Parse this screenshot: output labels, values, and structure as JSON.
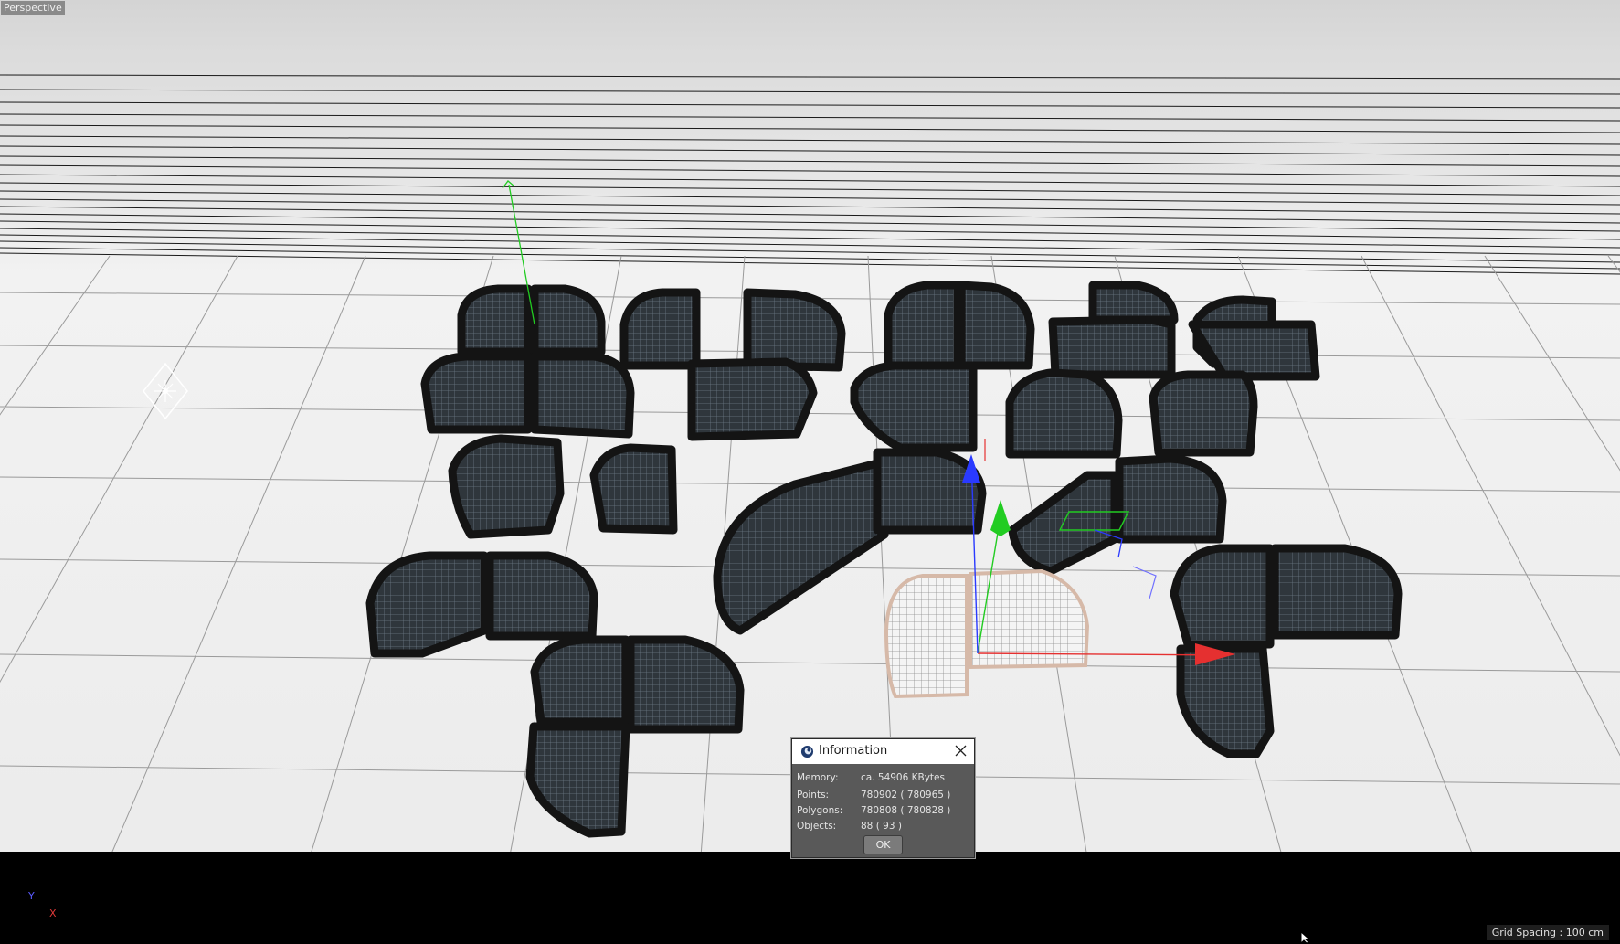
{
  "viewport": {
    "view_name": "Perspective",
    "grid_spacing": "Grid Spacing : 100 cm",
    "axis_indicator": {
      "y_label": "Y",
      "x_label": "X"
    }
  },
  "scene": {
    "object_color": "#1b1b1b",
    "wire_color": "#55606a",
    "selected_color": "#c8c8c8",
    "axis_colors": {
      "x": "#e53030",
      "y": "#22cc22",
      "z": "#2a3aff"
    },
    "light_icon": "light-icon"
  },
  "info_dialog": {
    "title": "Information",
    "app_icon": "cinema4d-icon",
    "close_icon": "close-icon",
    "rows": [
      {
        "label": "Memory:",
        "value": "ca. 54906 KBytes"
      },
      {
        "label": "Points:",
        "value": "780902 ( 780965 )"
      },
      {
        "label": "Polygons:",
        "value": "780808 ( 780828 )"
      },
      {
        "label": "Objects:",
        "value": "88 ( 93 )"
      }
    ],
    "ok_label": "OK"
  }
}
